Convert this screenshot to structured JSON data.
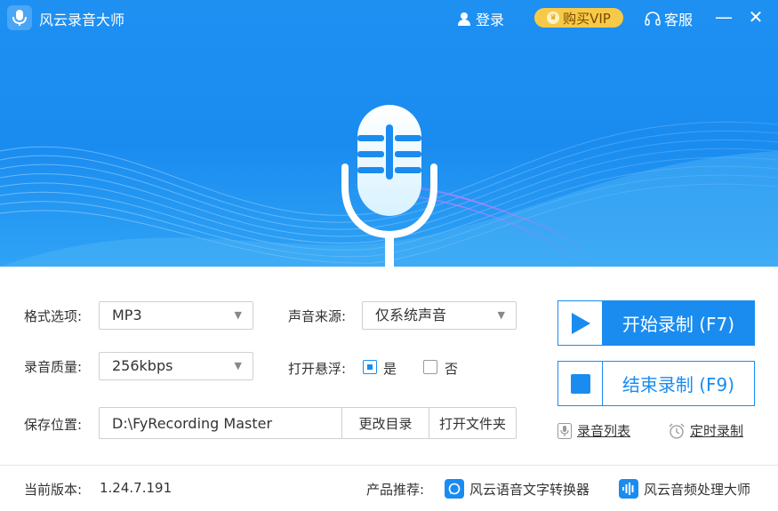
{
  "window": {
    "title": "风云录音大师",
    "login_label": "登录",
    "vip_label": "购买VIP",
    "service_label": "客服",
    "minimize_glyph": "—",
    "close_glyph": "✕"
  },
  "colors": {
    "primary": "#1a8cf0",
    "vip": "#f7c948",
    "hero_top": "#1e90f2"
  },
  "form": {
    "format_label": "格式选项:",
    "format_value": "MP3",
    "quality_label": "录音质量:",
    "quality_value": "256kbps",
    "source_label": "声音来源:",
    "source_value": "仅系统声音",
    "float_label": "打开悬浮:",
    "float_yes": "是",
    "float_no": "否",
    "float_selected": "是",
    "save_label": "保存位置:",
    "save_path": "D:\\FyRecording Master",
    "change_dir_label": "更改目录",
    "open_folder_label": "打开文件夹"
  },
  "actions": {
    "start_label": "开始录制 (F7)",
    "stop_label": "结束录制 (F9)",
    "list_label": "录音列表",
    "timer_label": "定时录制"
  },
  "footer": {
    "version_label": "当前版本:",
    "version_value": "1.24.7.191",
    "recommend_label": "产品推荐:",
    "product1": "风云语音文字转换器",
    "product2": "风云音频处理大师"
  },
  "icons": {
    "app": "microphone-icon",
    "login": "user-icon",
    "vip": "crown-icon",
    "service": "headset-icon",
    "start": "play-icon",
    "stop": "stop-icon",
    "list": "mic-list-icon",
    "timer": "alarm-clock-icon"
  }
}
